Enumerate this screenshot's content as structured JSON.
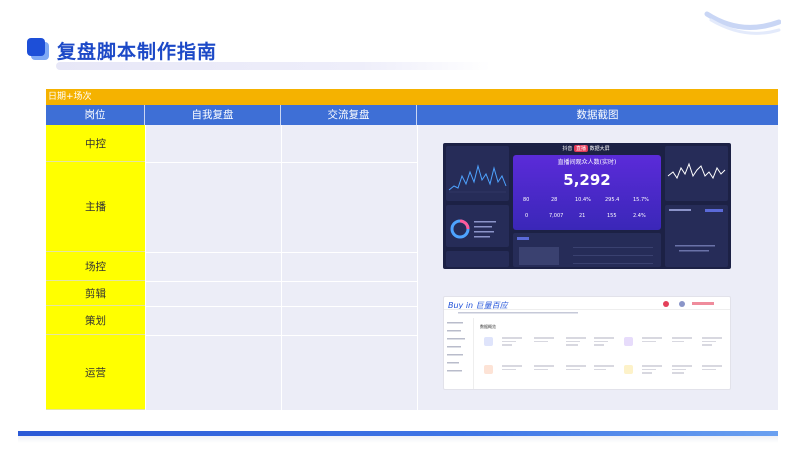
{
  "header": {
    "title": "复盘脚本制作指南"
  },
  "table": {
    "banner": "日期+场次",
    "columns": [
      "岗位",
      "自我复盘",
      "交流复盘",
      "数据截图"
    ],
    "roles": [
      "中控",
      "主播",
      "场控",
      "剪辑",
      "策划",
      "运营"
    ]
  },
  "dashboard": {
    "header": "抖音",
    "header_badge": "直播",
    "header_suffix": "数据大屏",
    "center_title": "直播间观众人数(实时)",
    "big_value": "5,292",
    "stats_row1": [
      "80",
      "28",
      "10.4%",
      "295.4",
      "15.7%"
    ],
    "stats_row2": [
      "0",
      "7,007",
      "21",
      "155",
      "2.4%"
    ]
  },
  "web": {
    "logo": "Buy in 巨量百应",
    "section_title": "数据概览"
  }
}
